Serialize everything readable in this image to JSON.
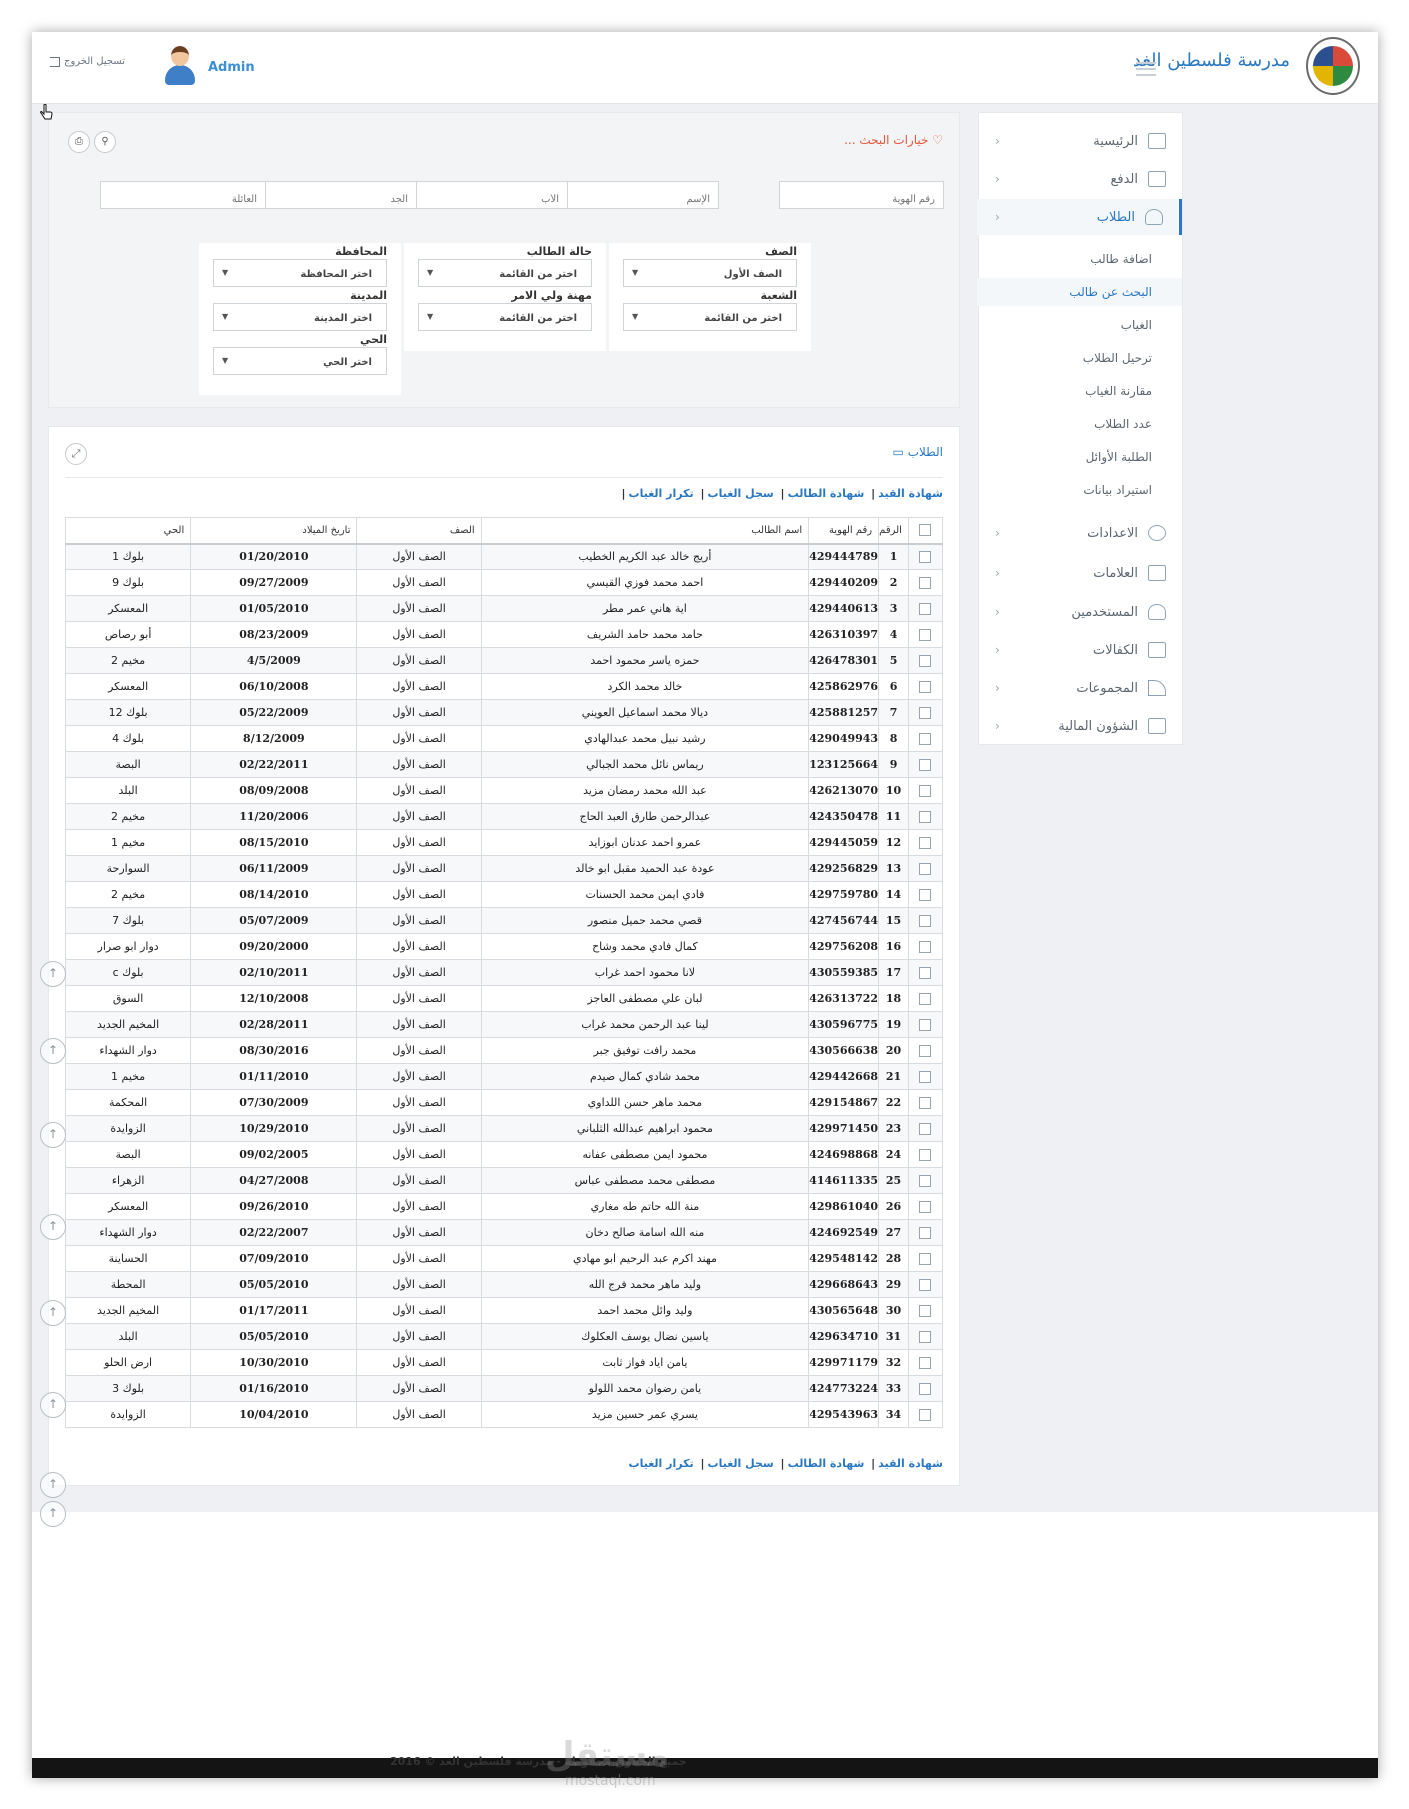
{
  "header": {
    "school_name": "مدرسة فلسطين الغد",
    "admin_name": "Admin",
    "logout_label": "تسجيل الخروج"
  },
  "sidebar": {
    "items": [
      {
        "label": "الرئيسية"
      },
      {
        "label": "الدفع"
      },
      {
        "label": "الطلاب"
      },
      {
        "label": "الاعدادات"
      },
      {
        "label": "العلامات"
      },
      {
        "label": "المستخدمين"
      },
      {
        "label": "الكفالات"
      },
      {
        "label": "المجموعات"
      },
      {
        "label": "الشؤون المالية"
      }
    ],
    "sub_items": [
      {
        "label": "اضافة طالب"
      },
      {
        "label": "البحث عن طالب"
      },
      {
        "label": "الغياب"
      },
      {
        "label": "ترحيل الطلاب"
      },
      {
        "label": "مقارنة الغياب"
      },
      {
        "label": "عدد الطلاب"
      },
      {
        "label": "الطلبة الأوائل"
      },
      {
        "label": "استيراد بيانات"
      }
    ]
  },
  "search": {
    "title": "خيارات البحث ...",
    "id_placeholder": "رقم الهوية",
    "name_placeholder": "الإسم",
    "father_placeholder": "الأب",
    "grandfather_placeholder": "الجد",
    "family_placeholder": "العائلة",
    "filters": {
      "class_label": "الصف",
      "class_value": "الصف الأول",
      "section_label": "الشعبة",
      "section_value": "اختر من القائمة",
      "status_label": "حالة الطالب",
      "status_value": "اختر من القائمة",
      "guardian_job_label": "مهنة ولي الامر",
      "guardian_job_value": "اختر من القائمة",
      "governorate_label": "المحافظة",
      "governorate_value": "اختر المحافظة",
      "city_label": "المدينة",
      "city_value": "اختر المدينة",
      "district_label": "الحي",
      "district_value": "اختر الحي"
    }
  },
  "students": {
    "title": "الطلاب",
    "links": [
      "شهادة القيد",
      "شهادة الطالب",
      "سجل الغياب",
      "تكرار الغياب"
    ],
    "columns": {
      "num": "الرقم",
      "id": "رقم الهوية",
      "name": "اسم الطالب",
      "class": "الصف",
      "dob": "تاريخ الميلاد",
      "district": "الحي"
    },
    "rows": [
      {
        "num": "1",
        "id": "429444789",
        "name": "أريج خالد عبد الكريم الخطيب",
        "class": "الصف الأول",
        "dob": "01/20/2010",
        "district": "بلوك 1"
      },
      {
        "num": "2",
        "id": "429440209",
        "name": "احمد محمد فوزي القيسي",
        "class": "الصف الأول",
        "dob": "09/27/2009",
        "district": "بلوك 9"
      },
      {
        "num": "3",
        "id": "429440613",
        "name": "اية هاني عمر مطر",
        "class": "الصف الأول",
        "dob": "01/05/2010",
        "district": "المعسكر"
      },
      {
        "num": "4",
        "id": "426310397",
        "name": "حامد محمد حامد الشريف",
        "class": "الصف الأول",
        "dob": "08/23/2009",
        "district": "أبو رصاص"
      },
      {
        "num": "5",
        "id": "426478301",
        "name": "حمزه ياسر محمود احمد",
        "class": "الصف الأول",
        "dob": "4/5/2009",
        "district": "مخيم 2"
      },
      {
        "num": "6",
        "id": "425862976",
        "name": "خالد محمد الكرد",
        "class": "الصف الأول",
        "dob": "06/10/2008",
        "district": "المعسكر"
      },
      {
        "num": "7",
        "id": "425881257",
        "name": "ديالا محمد اسماعيل العويني",
        "class": "الصف الأول",
        "dob": "05/22/2009",
        "district": "بلوك 12"
      },
      {
        "num": "8",
        "id": "429049943",
        "name": "رشيد نبيل محمد عبدالهادي",
        "class": "الصف الأول",
        "dob": "8/12/2009",
        "district": "بلوك 4"
      },
      {
        "num": "9",
        "id": "123125664",
        "name": "ريماس نائل محمد الجبالي",
        "class": "الصف الأول",
        "dob": "02/22/2011",
        "district": "البصة"
      },
      {
        "num": "10",
        "id": "426213070",
        "name": "عبد الله محمد رمضان مزيد",
        "class": "الصف الأول",
        "dob": "08/09/2008",
        "district": "البلد"
      },
      {
        "num": "11",
        "id": "424350478",
        "name": "عبدالرحمن طارق العبد الحاج",
        "class": "الصف الأول",
        "dob": "11/20/2006",
        "district": "مخيم 2"
      },
      {
        "num": "12",
        "id": "429445059",
        "name": "عمرو احمد عدنان ابوزايد",
        "class": "الصف الأول",
        "dob": "08/15/2010",
        "district": "مخيم 1"
      },
      {
        "num": "13",
        "id": "429256829",
        "name": "عودة عبد الحميد مقبل ابو خالد",
        "class": "الصف الأول",
        "dob": "06/11/2009",
        "district": "السوارحة"
      },
      {
        "num": "14",
        "id": "429759780",
        "name": "فادي ايمن محمد الحسنات",
        "class": "الصف الأول",
        "dob": "08/14/2010",
        "district": "مخيم 2"
      },
      {
        "num": "15",
        "id": "427456744",
        "name": "قصي محمد حميل منصور",
        "class": "الصف الأول",
        "dob": "05/07/2009",
        "district": "بلوك 7"
      },
      {
        "num": "16",
        "id": "429756208",
        "name": "كمال فادي محمد وشاح",
        "class": "الصف الأول",
        "dob": "09/20/2000",
        "district": "دوار ابو صرار"
      },
      {
        "num": "17",
        "id": "430559385",
        "name": "لانا محمود احمد غراب",
        "class": "الصف الأول",
        "dob": "02/10/2011",
        "district": "بلوك c"
      },
      {
        "num": "18",
        "id": "426313722",
        "name": "لبان علي مصطفى العاجز",
        "class": "الصف الأول",
        "dob": "12/10/2008",
        "district": "السوق"
      },
      {
        "num": "19",
        "id": "430596775",
        "name": "لينا عبد الرحمن محمد غراب",
        "class": "الصف الأول",
        "dob": "02/28/2011",
        "district": "المخيم الجديد"
      },
      {
        "num": "20",
        "id": "430566638",
        "name": "محمد رافت توفيق جبر",
        "class": "الصف الأول",
        "dob": "08/30/2016",
        "district": "دوار الشهداء"
      },
      {
        "num": "21",
        "id": "429442668",
        "name": "محمد شادي كمال صيدم",
        "class": "الصف الأول",
        "dob": "01/11/2010",
        "district": "مخيم 1"
      },
      {
        "num": "22",
        "id": "429154867",
        "name": "محمد ماهر حسن اللداوي",
        "class": "الصف الأول",
        "dob": "07/30/2009",
        "district": "المحكمة"
      },
      {
        "num": "23",
        "id": "429971450",
        "name": "محمود ابراهيم عبدالله الثلباني",
        "class": "الصف الأول",
        "dob": "10/29/2010",
        "district": "الزوايدة"
      },
      {
        "num": "24",
        "id": "424698868",
        "name": "محمود ايمن مصطفى عفانه",
        "class": "الصف الأول",
        "dob": "09/02/2005",
        "district": "البصة"
      },
      {
        "num": "25",
        "id": "414611335",
        "name": "مصطفى محمد مصطفى عباس",
        "class": "الصف الأول",
        "dob": "04/27/2008",
        "district": "الزهراء"
      },
      {
        "num": "26",
        "id": "429861040",
        "name": "منة الله حاتم طه مغاري",
        "class": "الصف الأول",
        "dob": "09/26/2010",
        "district": "المعسكر"
      },
      {
        "num": "27",
        "id": "424692549",
        "name": "منه الله اسامة صالح دخان",
        "class": "الصف الأول",
        "dob": "02/22/2007",
        "district": "دوار الشهداء"
      },
      {
        "num": "28",
        "id": "429548142",
        "name": "مهند اكرم عبد الرحيم ابو مهادي",
        "class": "الصف الأول",
        "dob": "07/09/2010",
        "district": "الحساينة"
      },
      {
        "num": "29",
        "id": "429668643",
        "name": "وليد ماهر محمد فرج الله",
        "class": "الصف الأول",
        "dob": "05/05/2010",
        "district": "المحطة"
      },
      {
        "num": "30",
        "id": "430565648",
        "name": "وليد وائل محمد احمد",
        "class": "الصف الأول",
        "dob": "01/17/2011",
        "district": "المخيم الجديد"
      },
      {
        "num": "31",
        "id": "429634710",
        "name": "ياسين نضال يوسف العكلوك",
        "class": "الصف الأول",
        "dob": "05/05/2010",
        "district": "البلد"
      },
      {
        "num": "32",
        "id": "429971179",
        "name": "يامن اياد فواز ثابت",
        "class": "الصف الأول",
        "dob": "10/30/2010",
        "district": "ارض الحلو"
      },
      {
        "num": "33",
        "id": "424773224",
        "name": "يامن رضوان محمد اللولو",
        "class": "الصف الأول",
        "dob": "01/16/2010",
        "district": "بلوك 3"
      },
      {
        "num": "34",
        "id": "429543963",
        "name": "يسري عمر حسين مزيد",
        "class": "الصف الأول",
        "dob": "10/04/2010",
        "district": "الزوايدة"
      }
    ]
  },
  "footer": {
    "copyright": "جميع الحقوق محفوظة - مدرسة فلسطين الغد © 2016",
    "watermark": "مستقل",
    "watermark_url": "mostaql.com"
  }
}
